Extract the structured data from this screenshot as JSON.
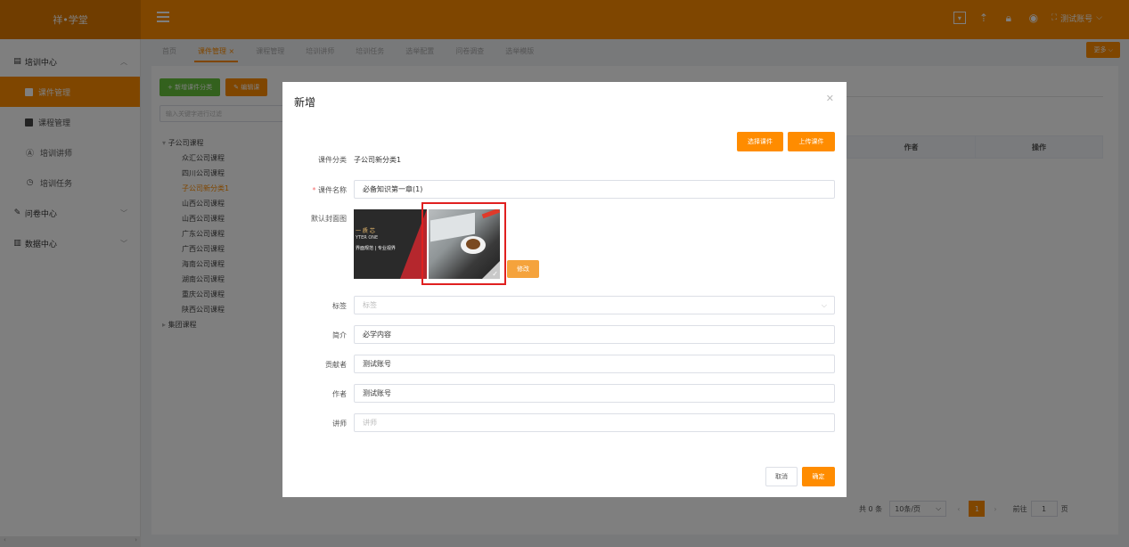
{
  "app": {
    "logo": "祥•学堂",
    "user": "测试账号"
  },
  "sidebar": {
    "groups": [
      {
        "label": "培训中心",
        "items": [
          {
            "label": "课件管理"
          },
          {
            "label": "课程管理"
          },
          {
            "label": "培训讲师"
          },
          {
            "label": "培训任务"
          }
        ]
      },
      {
        "label": "问卷中心"
      },
      {
        "label": "数据中心"
      }
    ]
  },
  "tabs": [
    {
      "label": "首页"
    },
    {
      "label": "课件管理"
    },
    {
      "label": "课程管理"
    },
    {
      "label": "培训讲师"
    },
    {
      "label": "培训任务"
    },
    {
      "label": "选举配置"
    },
    {
      "label": "问卷调查"
    },
    {
      "label": "选举模版"
    }
  ],
  "more_label": "更多",
  "content": {
    "add_category": "+ 新增课件分类",
    "edit_prefix": "编辑课",
    "search_placeholder": "输入关键字进行过滤",
    "tree": [
      {
        "label": "子公司课程",
        "children": [
          "众汇公司课程",
          "四川公司课程",
          "子公司新分类1",
          "山西公司课程",
          "山西公司课程",
          "广东公司课程",
          "广西公司课程",
          "海南公司课程",
          "湖南公司课程",
          "重庆公司课程",
          "陕西公司课程"
        ]
      },
      {
        "label": "集团课程"
      }
    ],
    "table_headers": {
      "author": "作者",
      "action": "操作"
    },
    "pagination": {
      "total": "共 0 条",
      "page_size": "10条/页",
      "current": "1",
      "goto": "前往",
      "goto_value": "1",
      "page_unit": "页"
    }
  },
  "modal": {
    "title": "新增",
    "select_btn": "选择课件",
    "upload_btn": "上传课件",
    "fields": {
      "category_label": "课件分类",
      "category_value": "子公司新分类1",
      "name_label": "课件名称",
      "name_value": "必备知识第一章(1)",
      "cover_label": "默认封面图",
      "cover_text1": "一 质 芯",
      "cover_text2": "YTER ONE",
      "cover_text3": "界面规范 | 专业视界",
      "modify_btn": "修改",
      "tag_label": "标签",
      "tag_placeholder": "标签",
      "intro_label": "简介",
      "intro_value": "必学内容",
      "contributor_label": "贡献者",
      "contributor_value": "测试账号",
      "author_label": "作者",
      "author_value": "测试账号",
      "lecturer_label": "讲师",
      "lecturer_placeholder": "讲师"
    },
    "cancel": "取消",
    "confirm": "确定"
  }
}
